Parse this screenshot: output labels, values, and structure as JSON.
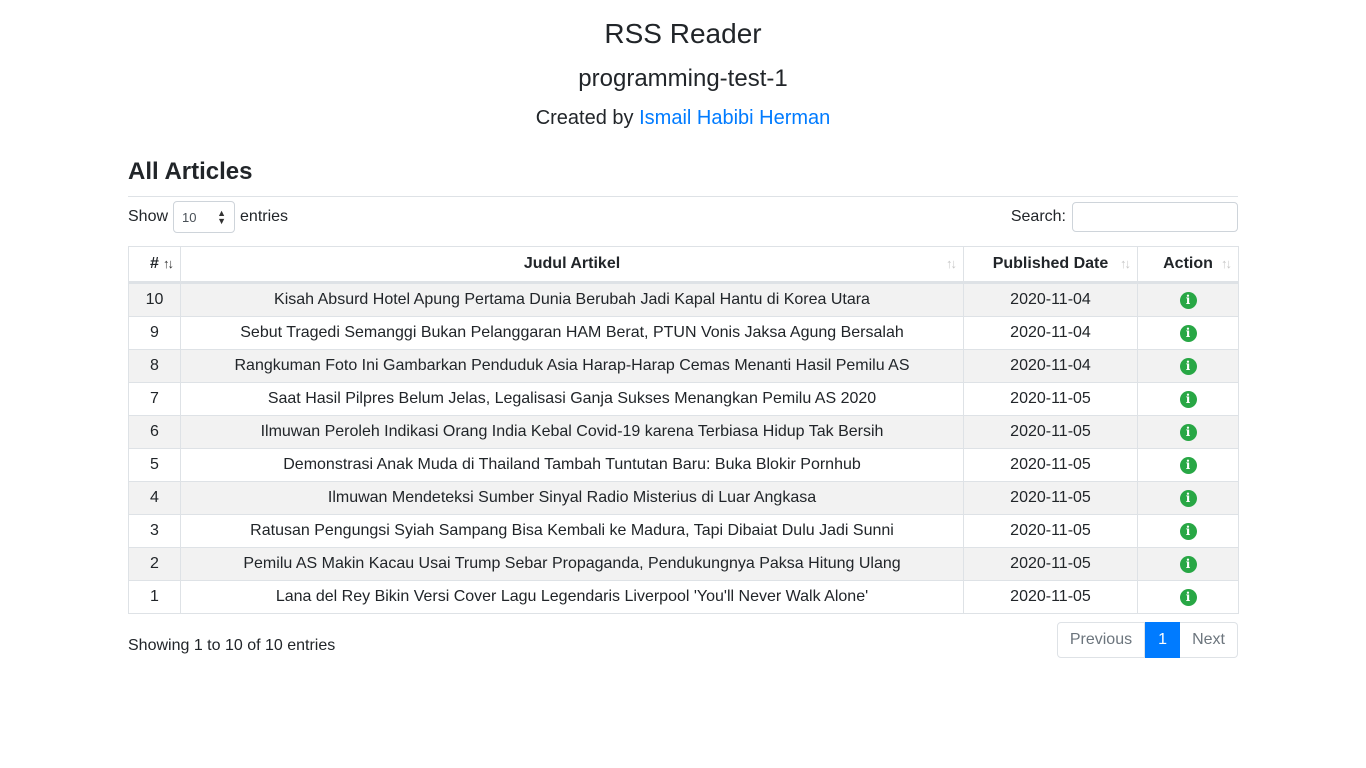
{
  "header": {
    "title": "RSS Reader",
    "subtitle": "programming-test-1",
    "credit_prefix": "Created by",
    "author": "Ismail Habibi Herman"
  },
  "section_title": "All Articles",
  "length_control": {
    "show_label": "Show",
    "value": "10",
    "entries_label": "entries"
  },
  "search": {
    "label": "Search:",
    "value": ""
  },
  "table": {
    "headers": [
      "#",
      "Judul Artikel",
      "Published Date",
      "Action"
    ],
    "rows": [
      {
        "num": "10",
        "title": "Kisah Absurd Hotel Apung Pertama Dunia Berubah Jadi Kapal Hantu di Korea Utara",
        "date": "2020-11-04"
      },
      {
        "num": "9",
        "title": "Sebut Tragedi Semanggi Bukan Pelanggaran HAM Berat, PTUN Vonis Jaksa Agung Bersalah",
        "date": "2020-11-04"
      },
      {
        "num": "8",
        "title": "Rangkuman Foto Ini Gambarkan Penduduk Asia Harap-Harap Cemas Menanti Hasil Pemilu AS",
        "date": "2020-11-04"
      },
      {
        "num": "7",
        "title": "Saat Hasil Pilpres Belum Jelas, Legalisasi Ganja Sukses Menangkan Pemilu AS 2020",
        "date": "2020-11-05"
      },
      {
        "num": "6",
        "title": "Ilmuwan Peroleh Indikasi Orang India Kebal Covid-19 karena Terbiasa Hidup Tak Bersih",
        "date": "2020-11-05"
      },
      {
        "num": "5",
        "title": "Demonstrasi Anak Muda di Thailand Tambah Tuntutan Baru: Buka Blokir Pornhub",
        "date": "2020-11-05"
      },
      {
        "num": "4",
        "title": "Ilmuwan Mendeteksi Sumber Sinyal Radio Misterius di Luar Angkasa",
        "date": "2020-11-05"
      },
      {
        "num": "3",
        "title": "Ratusan Pengungsi Syiah Sampang Bisa Kembali ke Madura, Tapi Dibaiat Dulu Jadi Sunni",
        "date": "2020-11-05"
      },
      {
        "num": "2",
        "title": "Pemilu AS Makin Kacau Usai Trump Sebar Propaganda, Pendukungnya Paksa Hitung Ulang",
        "date": "2020-11-05"
      },
      {
        "num": "1",
        "title": "Lana del Rey Bikin Versi Cover Lagu Legendaris Liverpool 'You'll Never Walk Alone'",
        "date": "2020-11-05"
      }
    ]
  },
  "footer": {
    "info": "Showing 1 to 10 of 10 entries",
    "previous": "Previous",
    "current_page": "1",
    "next": "Next"
  },
  "colors": {
    "accent": "#007bff",
    "action_icon": "#28a745",
    "stripe": "#f2f2f2"
  },
  "icons": {
    "action": "info-circle-icon",
    "sort": "sort-icon"
  }
}
